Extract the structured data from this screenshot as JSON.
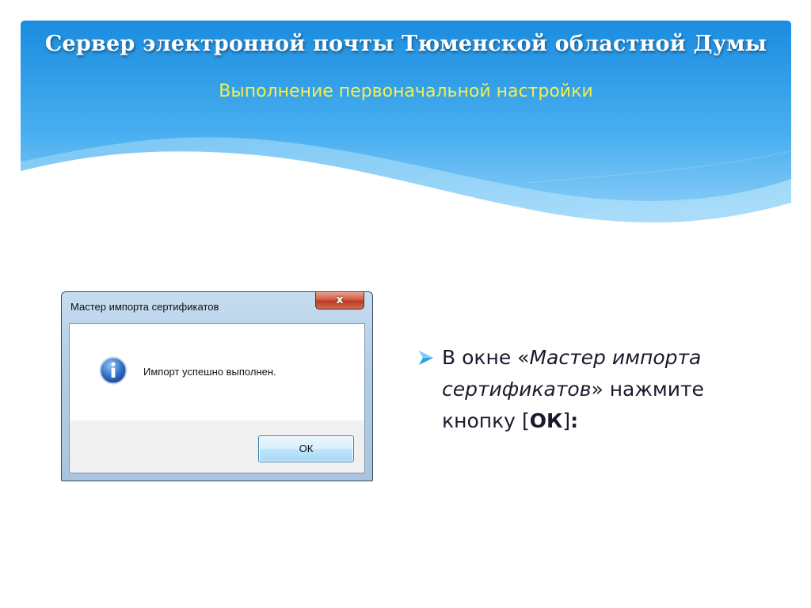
{
  "slide": {
    "title": "Сервер электронной почты Тюменской областной Думы",
    "subtitle": "Выполнение первоначальной настройки",
    "colors": {
      "banner_top": "#1b8ee0",
      "banner_bottom": "#7cc6f5",
      "title": "#ffffff",
      "subtitle": "#f2f04a",
      "bullet_arrow": "#2aa3dc"
    }
  },
  "dialog": {
    "title": "Мастер импорта сертификатов",
    "close_glyph": "x",
    "icon": "info-icon",
    "message": "Импорт успешно выполнен.",
    "ok_label": "ОК"
  },
  "bullet": {
    "icon": "arrow-bullet-icon",
    "prefix": "В окне «",
    "italic_name": "Мастер импорта сертификатов",
    "middle": "» нажмите кнопку ",
    "bracket_open": "[",
    "button_name": "ОК",
    "bracket_close": "]",
    "suffix": ":"
  }
}
